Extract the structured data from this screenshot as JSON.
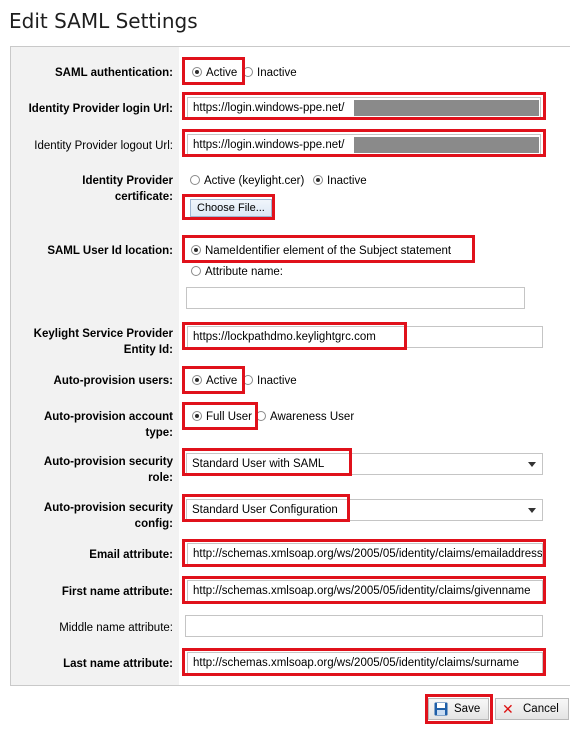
{
  "window": {
    "title": "Edit SAML Settings"
  },
  "saml_auth": {
    "label": "SAML authentication:",
    "opt_active": "Active",
    "opt_inactive": "Inactive",
    "selected": "Active"
  },
  "idp_login": {
    "label": "Identity Provider login Url:",
    "value": "https://login.windows-ppe.net/"
  },
  "idp_logout": {
    "label": "Identity Provider logout Url:",
    "value": "https://login.windows-ppe.net/"
  },
  "idp_cert": {
    "label_line1": "Identity Provider",
    "label_line2": "certificate:",
    "opt_active": "Active (keylight.cer)",
    "opt_inactive": "Inactive",
    "selected": "Inactive",
    "choose_label": "Choose File..."
  },
  "user_id_loc": {
    "label": "SAML User Id location:",
    "opt_nameid": "NameIdentifier element of the Subject statement",
    "opt_attr": "Attribute name:",
    "attr_value": ""
  },
  "sp_entity": {
    "label_line1": "Keylight Service Provider",
    "label_line2": "Entity Id:",
    "value": "https://lockpathdmo.keylightgrc.com"
  },
  "auto_users": {
    "label": "Auto-provision users:",
    "opt_active": "Active",
    "opt_inactive": "Inactive",
    "selected": "Active"
  },
  "auto_type": {
    "label_line1": "Auto-provision account",
    "label_line2": "type:",
    "opt_full": "Full User",
    "opt_awareness": "Awareness User",
    "selected": "Full User"
  },
  "auto_role": {
    "label_line1": "Auto-provision security",
    "label_line2": "role:",
    "value": "Standard User with SAML"
  },
  "auto_config": {
    "label_line1": "Auto-provision security",
    "label_line2": "config:",
    "value": "Standard User Configuration"
  },
  "email_attr": {
    "label": "Email attribute:",
    "value": "http://schemas.xmlsoap.org/ws/2005/05/identity/claims/emailaddress"
  },
  "first_attr": {
    "label": "First name attribute:",
    "value": "http://schemas.xmlsoap.org/ws/2005/05/identity/claims/givenname"
  },
  "middle_attr": {
    "label": "Middle name attribute:",
    "value": ""
  },
  "last_attr": {
    "label": "Last name attribute:",
    "value": "http://schemas.xmlsoap.org/ws/2005/05/identity/claims/surname"
  },
  "footer": {
    "save_label": "Save",
    "cancel_label": "Cancel"
  },
  "colors": {
    "highlight": "#e0111b",
    "panel_bg": "#f2f2f2",
    "save_icon": "#1f5fa8",
    "cancel_icon": "#d11"
  }
}
